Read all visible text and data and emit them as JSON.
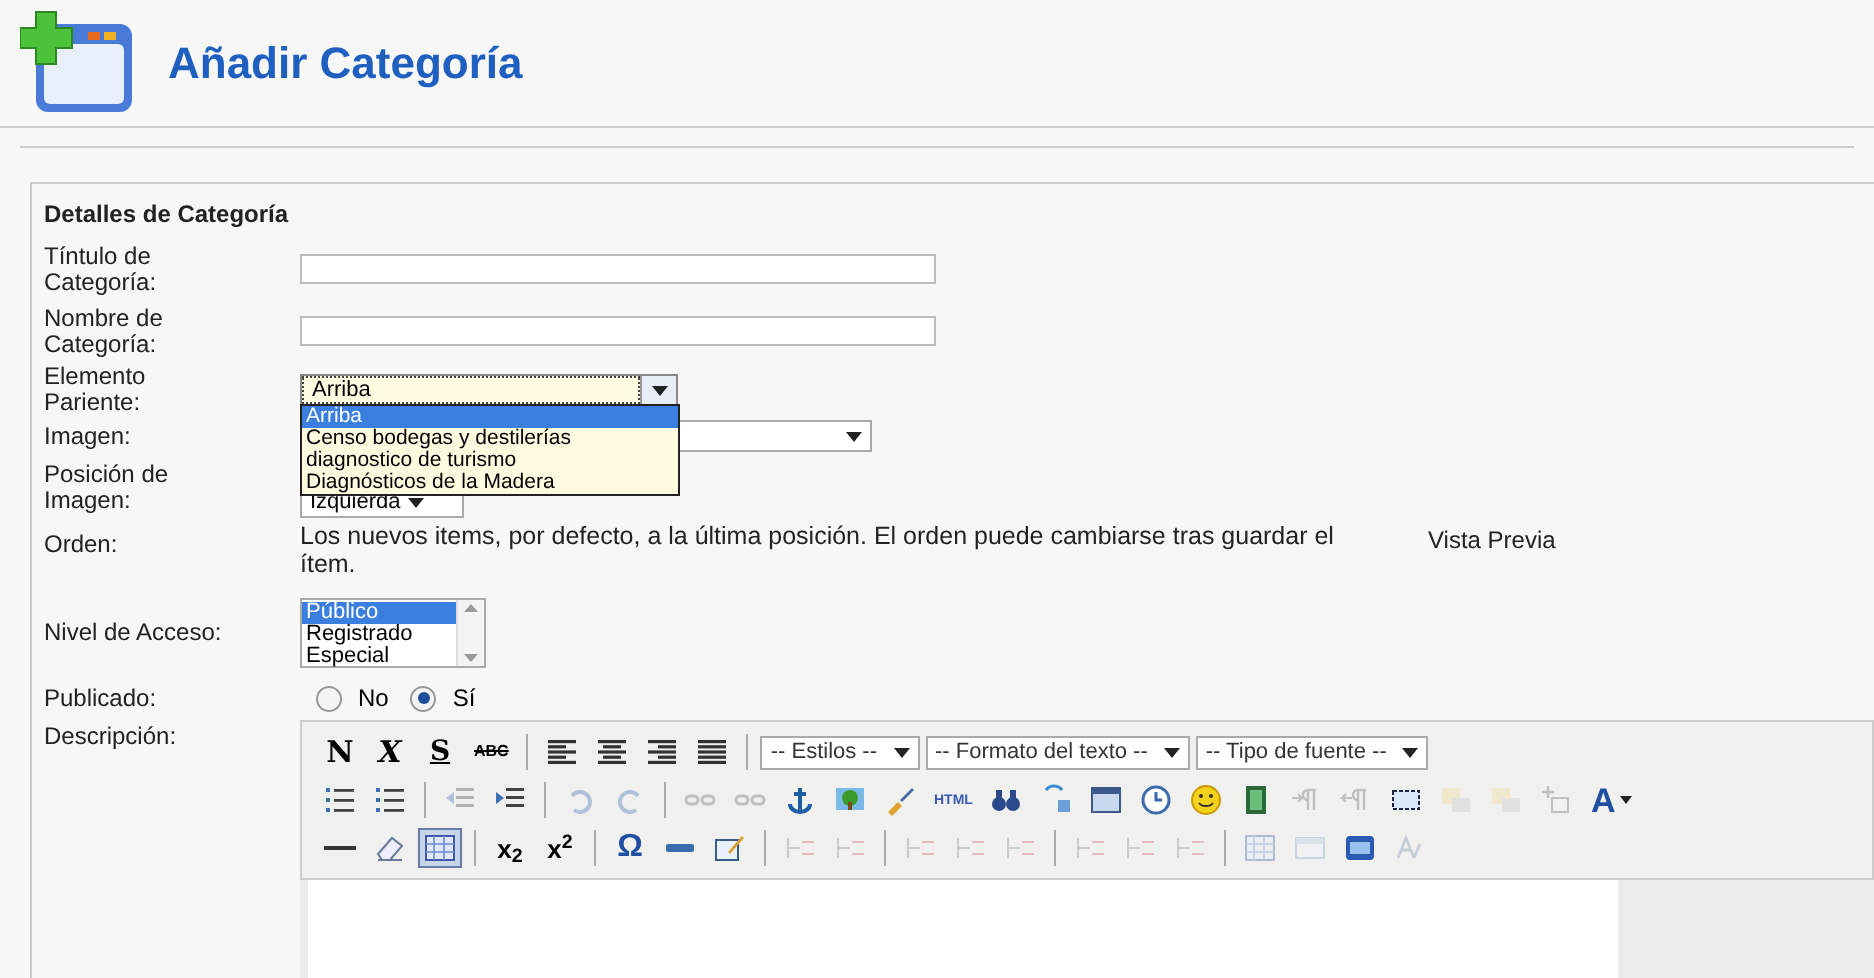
{
  "header": {
    "title": "Añadir Categoría"
  },
  "section": {
    "legend": "Detalles de Categoría"
  },
  "fields": [
    {
      "kind": "text",
      "label": "Tíntulo de Categoría:"
    },
    {
      "kind": "text",
      "label": "Nombre de Categoría:"
    },
    {
      "kind": "dropdown",
      "label": "Elemento Pariente:",
      "value": "Arriba",
      "expanded": true,
      "options": [
        {
          "label": "Arriba",
          "selected": true
        },
        {
          "label": "Censo bodegas y destilerías",
          "selected": false
        },
        {
          "label": "diagnostico de turismo",
          "selected": false
        },
        {
          "label": "Diagnósticos de la Madera",
          "selected": false
        }
      ]
    },
    {
      "kind": "select",
      "label": "Imagen:"
    },
    {
      "kind": "select_small",
      "label": "Posición de Imagen:",
      "value": "Izquierda"
    },
    {
      "kind": "note",
      "label": "Orden:",
      "value": "Los nuevos items, por defecto, a la última posición. El orden puede cambiarse tras guardar el ítem.",
      "aside": "Vista Previa"
    },
    {
      "kind": "listbox",
      "label": "Nivel de Acceso:",
      "options": [
        {
          "label": "Público",
          "selected": true
        },
        {
          "label": "Registrado",
          "selected": false
        },
        {
          "label": "Especial",
          "selected": false
        }
      ]
    },
    {
      "kind": "radio",
      "label": "Publicado:",
      "options": [
        {
          "label": "No",
          "selected": false
        },
        {
          "label": "Sí",
          "selected": true
        }
      ]
    },
    {
      "kind": "editor",
      "label": "Descripción:"
    }
  ],
  "toolbar": [
    [
      {
        "kind": "text",
        "label": "N",
        "disabled": false
      },
      {
        "kind": "text",
        "label": "X",
        "disabled": false
      },
      {
        "kind": "text",
        "label": "S",
        "disabled": false
      },
      {
        "kind": "text",
        "label": "ABC",
        "disabled": false
      },
      {
        "kind": "separator"
      },
      {
        "kind": "icon",
        "disabled": false
      },
      {
        "kind": "icon",
        "disabled": false
      },
      {
        "kind": "icon",
        "disabled": false
      },
      {
        "kind": "icon",
        "disabled": false
      },
      {
        "kind": "separator"
      },
      {
        "kind": "select",
        "label": "-- Estilos --"
      },
      {
        "kind": "select",
        "label": "-- Formato del texto --"
      },
      {
        "kind": "select",
        "label": "-- Tipo de fuente --"
      }
    ],
    [
      {
        "kind": "icon",
        "disabled": false
      },
      {
        "kind": "icon",
        "disabled": false
      },
      {
        "kind": "separator"
      },
      {
        "kind": "icon",
        "disabled": true
      },
      {
        "kind": "icon",
        "disabled": false
      },
      {
        "kind": "separator"
      },
      {
        "kind": "icon",
        "disabled": true
      },
      {
        "kind": "icon",
        "disabled": true
      },
      {
        "kind": "separator"
      },
      {
        "kind": "icon",
        "disabled": true
      },
      {
        "kind": "icon",
        "disabled": true
      },
      {
        "kind": "icon",
        "disabled": false
      },
      {
        "kind": "icon",
        "disabled": false
      },
      {
        "kind": "icon",
        "disabled": false
      },
      {
        "kind": "text",
        "label": "HTML",
        "disabled": false
      },
      {
        "kind": "icon",
        "disabled": false
      },
      {
        "kind": "icon",
        "disabled": false
      },
      {
        "kind": "icon",
        "disabled": false
      },
      {
        "kind": "icon",
        "disabled": false
      },
      {
        "kind": "icon",
        "disabled": false
      },
      {
        "kind": "icon",
        "disabled": false
      },
      {
        "kind": "icon",
        "disabled": true
      },
      {
        "kind": "icon",
        "disabled": true
      },
      {
        "kind": "icon",
        "disabled": false
      },
      {
        "kind": "icon",
        "disabled": true
      },
      {
        "kind": "icon",
        "disabled": true
      },
      {
        "kind": "icon",
        "disabled": true
      },
      {
        "kind": "text",
        "label": "A",
        "disabled": false
      }
    ],
    [
      {
        "kind": "icon",
        "disabled": false
      },
      {
        "kind": "icon",
        "disabled": false
      },
      {
        "kind": "icon",
        "disabled": false,
        "selected": true
      },
      {
        "kind": "separator"
      },
      {
        "kind": "text",
        "label": "x$_{2}$",
        "disabled": false
      },
      {
        "kind": "text",
        "label": "x$^{2}$",
        "disabled": false
      },
      {
        "kind": "separator"
      },
      {
        "kind": "text",
        "label": "Ω",
        "disabled": false
      },
      {
        "kind": "icon",
        "disabled": false
      },
      {
        "kind": "icon",
        "disabled": false
      },
      {
        "kind": "separator"
      },
      {
        "kind": "icon",
        "disabled": true
      },
      {
        "kind": "icon",
        "disabled": true
      },
      {
        "kind": "separator"
      },
      {
        "kind": "icon",
        "disabled": true
      },
      {
        "kind": "icon",
        "disabled": true
      },
      {
        "kind": "icon",
        "disabled": true
      },
      {
        "kind": "separator"
      },
      {
        "kind": "icon",
        "disabled": true
      },
      {
        "kind": "icon",
        "disabled": true
      },
      {
        "kind": "icon",
        "disabled": true
      },
      {
        "kind": "separator"
      },
      {
        "kind": "icon",
        "disabled": true
      },
      {
        "kind": "icon",
        "disabled": true
      },
      {
        "kind": "icon",
        "disabled": false
      },
      {
        "kind": "icon",
        "disabled": true
      }
    ]
  ]
}
